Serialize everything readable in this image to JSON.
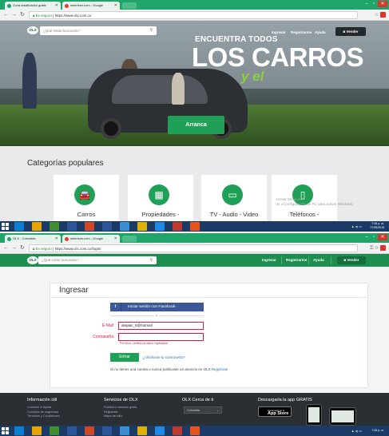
{
  "screen1": {
    "tabs": [
      {
        "label": "Zona clasificados gratis",
        "color": "#1fa56a"
      },
      {
        "label": "selenium.com - Google",
        "color": "#e43b2f"
      }
    ],
    "url_secure": "Es seguro",
    "url": "https://www.olx.com.co",
    "search_placeholder": "¿Qué estás buscando?",
    "nav": {
      "login": "Ingresar",
      "register": "Registrarme",
      "help": "Ayuda",
      "sell": "Vender"
    },
    "logo": "OLX",
    "hero": {
      "line1": "ENCUENTRA TODOS",
      "line2": "LOS CARROS",
      "line3": "y el",
      "cta": "Arranca"
    },
    "categories_title": "Categorías populares",
    "categories": [
      {
        "label": "Carros",
        "icon": "car-icon",
        "glyph": "🚘"
      },
      {
        "label": "Propiedades -",
        "icon": "building-icon",
        "glyph": "▦"
      },
      {
        "label": "TV - Audio - Video",
        "icon": "tv-icon",
        "glyph": "▭"
      },
      {
        "label": "Teléfonos -",
        "icon": "phone-icon",
        "glyph": "▯"
      }
    ],
    "watermark": [
      "Activar Windows",
      "Ve a Configuración de PC para activar Windows."
    ],
    "clock": {
      "time": "7:06 p. m.",
      "date": "27/05/2018"
    }
  },
  "screen2": {
    "tabs": [
      {
        "label": "OLX - Colombia",
        "color": "#1fa56a"
      },
      {
        "label": "selenium.com - Google",
        "color": "#e43b2f"
      }
    ],
    "url_secure": "Es seguro",
    "url": "https://www.olx.com.co/login/",
    "logo": "OLX",
    "search_placeholder": "¿Qué estás buscando?",
    "nav": {
      "login": "Ingresar",
      "register": "Registrarme",
      "help": "Ayuda",
      "sell": "Vender"
    },
    "login": {
      "title": "Ingresar",
      "facebook": "Iniciar sesión con Facebook",
      "or": "o",
      "email_label": "E-Mail",
      "email_value": "aleptac_5@hotmail",
      "password_label": "Contraseña",
      "password_value": "",
      "error": "Por favor, verifica los datos ingresados",
      "submit": "Entrar",
      "forgot": "¿Olvidaste tu contraseña?",
      "register_prefix": "Si no tienes una cuenta o nunca publicaste un anuncio en OLX",
      "register_link": "Registrate"
    },
    "footer": {
      "col1": {
        "title": "Información útil",
        "items": [
          "Contacto & Ayuda",
          "Consejos de seguridad",
          "Términos y Condiciones"
        ]
      },
      "col2": {
        "title": "Servicios de OLX",
        "items": [
          "Publicá tu anuncio gratis",
          "Regístrate",
          "Mapa del sitio"
        ]
      },
      "col3": {
        "title": "OLX Cerca de ti",
        "select": "Colombia"
      },
      "col4": {
        "title": "Descargarla la app GRATIS",
        "store_top": "Consíguelo en el",
        "store": "App Store"
      }
    },
    "clock": {
      "time": "7:06 p. m.",
      "date": ""
    }
  },
  "taskbar_apps": [
    "#0a7fd4",
    "#e8a500",
    "#3e8e2f",
    "#2b579a",
    "#d24726",
    "#2b579a",
    "#3c8dd0",
    "#e0b000",
    "#1e88e5",
    "#c0392b",
    "#e8541c"
  ]
}
